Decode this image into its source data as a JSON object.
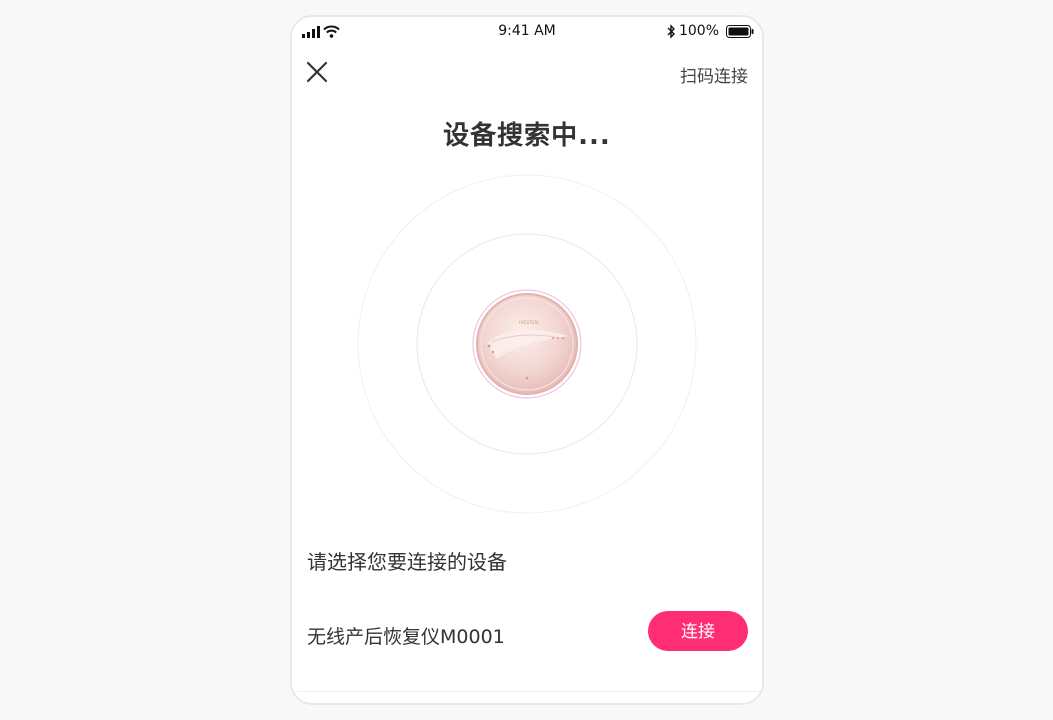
{
  "status_bar": {
    "time": "9:41 AM",
    "battery": "100%"
  },
  "header": {
    "scan_label": "扫码连接",
    "title": "设备搜索中..."
  },
  "device_image": {
    "brand_text": "IVESTEN"
  },
  "devices": {
    "section_title": "请选择您要连接的设备",
    "items": [
      {
        "name": "无线产后恢复仪M0001",
        "action_label": "连接"
      }
    ]
  },
  "colors": {
    "accent": "#ff2d74",
    "radar_ring": "#f3e3ea",
    "device_body": "#f6dad8"
  }
}
